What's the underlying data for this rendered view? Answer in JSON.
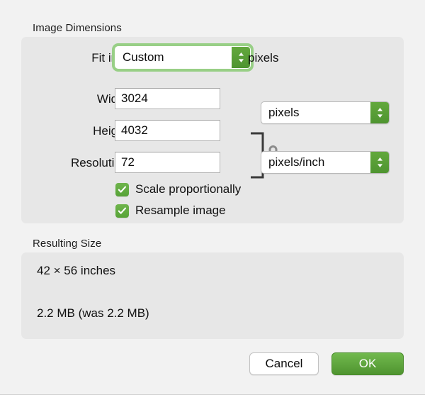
{
  "dialog": {
    "sections": {
      "image_dimensions_title": "Image Dimensions",
      "resulting_size_title": "Resulting Size"
    },
    "fit_into": {
      "label": "Fit into:",
      "value": "Custom",
      "unit_suffix": "pixels",
      "focused": true,
      "stepper_icon": "stepper-up-down-icon"
    },
    "width": {
      "label": "Width:",
      "value": "3024"
    },
    "height": {
      "label": "Height:",
      "value": "4032"
    },
    "size_unit": {
      "value": "pixels",
      "stepper_icon": "stepper-up-down-icon"
    },
    "resolution": {
      "label": "Resolution:",
      "value": "72"
    },
    "resolution_unit": {
      "value": "pixels/inch",
      "stepper_icon": "stepper-up-down-icon"
    },
    "link_lock": {
      "icon": "lock-closed-icon",
      "state": "locked"
    },
    "checkboxes": [
      {
        "label": "Scale proportionally",
        "checked": true
      },
      {
        "label": "Resample image",
        "checked": true
      }
    ],
    "resulting_size": {
      "dimensions": "42 × 56 inches",
      "file_size": "2.2 MB (was 2.2 MB)"
    },
    "buttons": {
      "cancel": "Cancel",
      "ok": "OK"
    },
    "colors": {
      "accent_green": "#5ba23a",
      "focus_ring_green": "#98cf86",
      "window_background": "#f2f2f2",
      "group_background": "#e7e7e7",
      "field_background": "#ffffff",
      "text": "#111111"
    }
  }
}
